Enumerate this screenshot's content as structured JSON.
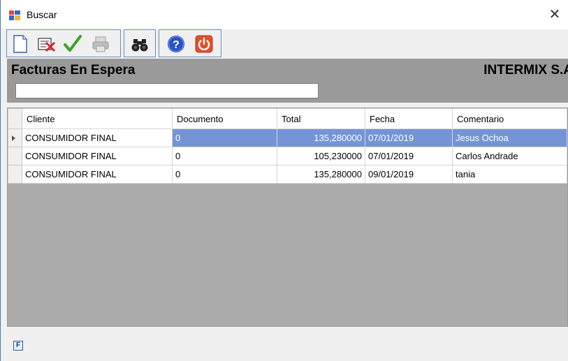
{
  "window": {
    "title": "Buscar",
    "close_glyph": "✕"
  },
  "toolbar": {
    "buttons": [
      {
        "name": "new-document-icon"
      },
      {
        "name": "edit-document-icon"
      },
      {
        "name": "checkmark-icon"
      },
      {
        "name": "print-icon-disabled"
      },
      {
        "name": "binoculars-icon"
      },
      {
        "name": "help-icon"
      },
      {
        "name": "power-icon"
      }
    ]
  },
  "header": {
    "title": "Facturas En Espera",
    "company": "INTERMIX S.A",
    "search_value": ""
  },
  "grid": {
    "columns": [
      "Cliente",
      "Documento",
      "Total",
      "Fecha",
      "Comentario"
    ],
    "rows": [
      {
        "cliente": "CONSUMIDOR FINAL",
        "documento": "0",
        "total": "135,280000",
        "fecha": "07/01/2019",
        "comentario": "Jesus Ochoa"
      },
      {
        "cliente": "CONSUMIDOR FINAL",
        "documento": "0",
        "total": "105,230000",
        "fecha": "07/01/2019",
        "comentario": "Carlos Andrade"
      },
      {
        "cliente": "CONSUMIDOR FINAL",
        "documento": "0",
        "total": "135,280000",
        "fecha": "09/01/2019",
        "comentario": "tania"
      }
    ],
    "selected_row": 0
  },
  "footer": {
    "button_label": "F"
  },
  "colors": {
    "header_bg": "#9a9a9a",
    "selection": "#7594d8",
    "border_accent": "#3c7fb1"
  }
}
